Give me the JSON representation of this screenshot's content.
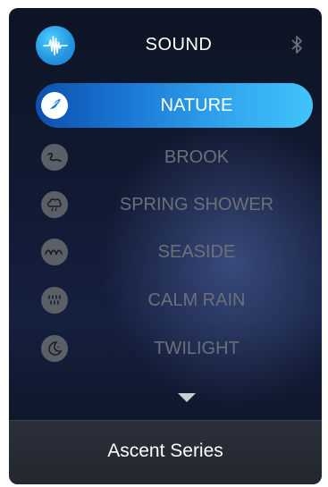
{
  "header": {
    "title": "SOUND",
    "logo_icon": "waveform-icon",
    "right_icon": "bluetooth-icon"
  },
  "sounds": [
    {
      "label": "NATURE",
      "icon": "bird-icon",
      "selected": true
    },
    {
      "label": "BROOK",
      "icon": "stream-icon",
      "selected": false
    },
    {
      "label": "SPRING SHOWER",
      "icon": "cloud-rain-icon",
      "selected": false
    },
    {
      "label": "SEASIDE",
      "icon": "waves-icon",
      "selected": false
    },
    {
      "label": "CALM RAIN",
      "icon": "raindrops-icon",
      "selected": false
    },
    {
      "label": "TWILIGHT",
      "icon": "moon-icon",
      "selected": false
    }
  ],
  "more_icon": "chevron-down-icon",
  "footer": {
    "text": "Ascent Series"
  },
  "colors": {
    "accent_start": "#0d4fae",
    "accent_end": "#40c4fb",
    "inactive_text": "#6b7079",
    "logo_blue": "#2597e0"
  }
}
